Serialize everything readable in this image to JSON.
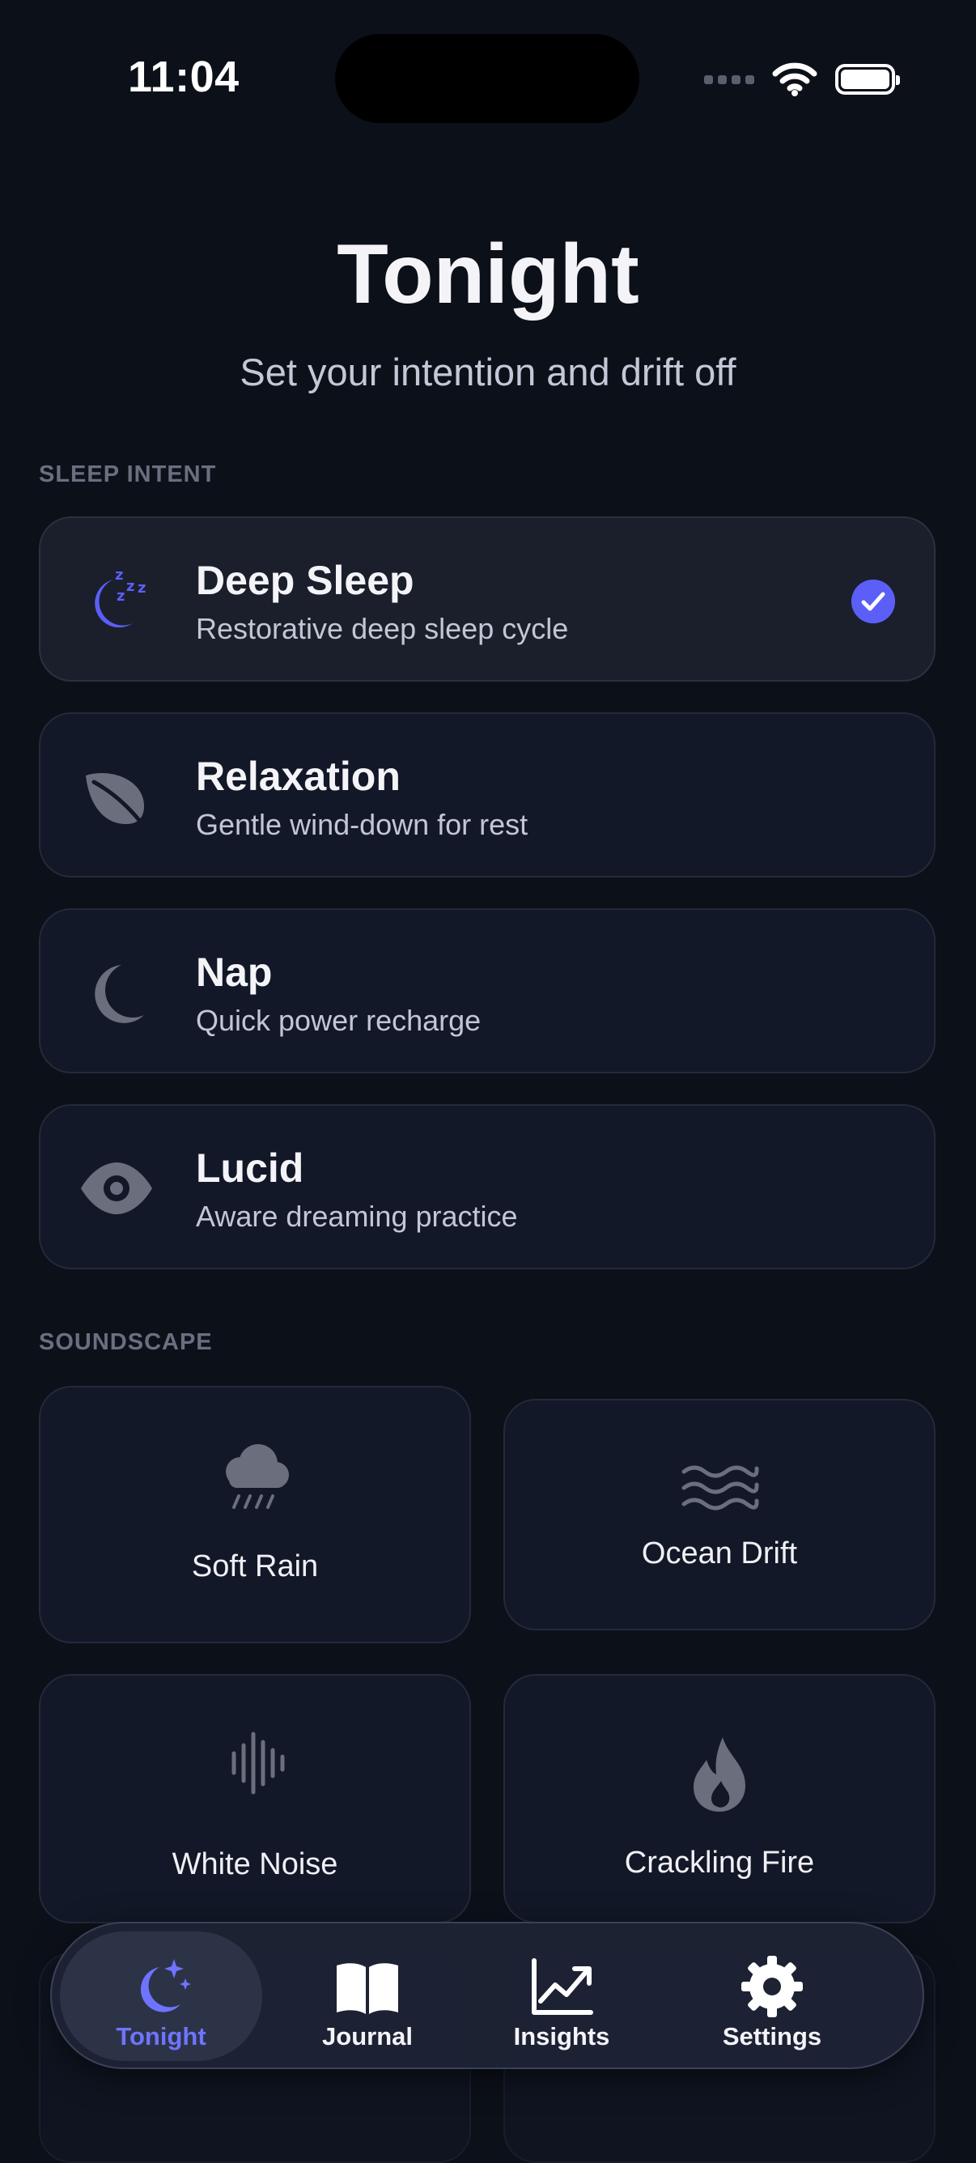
{
  "status_bar": {
    "time": "11:04"
  },
  "header": {
    "title": "Tonight",
    "subtitle": "Set your intention and drift off"
  },
  "sleep_intent": {
    "section_label": "SLEEP INTENT",
    "selected": "Deep Sleep",
    "items": [
      {
        "title": "Deep Sleep",
        "subtitle": "Restorative deep sleep cycle",
        "icon": "moon-zzz-icon"
      },
      {
        "title": "Relaxation",
        "subtitle": "Gentle wind-down for rest",
        "icon": "leaf-icon"
      },
      {
        "title": "Nap",
        "subtitle": "Quick power recharge",
        "icon": "moon-icon"
      },
      {
        "title": "Lucid",
        "subtitle": "Aware dreaming practice",
        "icon": "eye-icon"
      }
    ]
  },
  "soundscape": {
    "section_label": "SOUNDSCAPE",
    "items": [
      {
        "label": "Soft Rain",
        "icon": "rain-cloud-icon"
      },
      {
        "label": "Ocean Drift",
        "icon": "waves-icon"
      },
      {
        "label": "White Noise",
        "icon": "waveform-icon"
      },
      {
        "label": "Crackling Fire",
        "icon": "flame-icon"
      }
    ]
  },
  "tab_bar": {
    "active": "Tonight",
    "tabs": [
      {
        "label": "Tonight",
        "icon": "moon-stars-icon"
      },
      {
        "label": "Journal",
        "icon": "book-icon"
      },
      {
        "label": "Insights",
        "icon": "chart-icon"
      },
      {
        "label": "Settings",
        "icon": "gear-icon"
      }
    ]
  },
  "colors": {
    "background": "#0c1019",
    "card": "#121827",
    "accent": "#5b5ff7",
    "icon_muted": "#6b6e7c",
    "tab_active_text": "#6e74ff"
  }
}
